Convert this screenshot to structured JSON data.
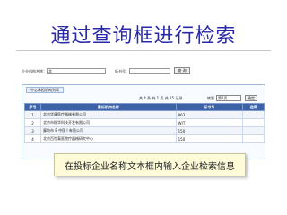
{
  "slide": {
    "title": "通过查询框进行检索"
  },
  "search": {
    "name_label": "企业机构名称：",
    "name_value": "北",
    "number_label": "标书号：",
    "number_value": "",
    "query_button": "查 询"
  },
  "panel": {
    "tab_label": "中心承担机构列表"
  },
  "pager": {
    "info": "共 4 条  共 1 页  共 15 记录",
    "jump_label": "转到",
    "page_select": "第1页",
    "go_button": "确定"
  },
  "table": {
    "headers": [
      "序号",
      "委标机构名称",
      "标书号",
      "选择"
    ],
    "rows": [
      {
        "no": "1",
        "name": "北京华康医疗器械有限公司",
        "number": "963",
        "select": ""
      },
      {
        "no": "2",
        "name": "北京市振华科技开发有限公司",
        "number": "W/T",
        "select": ""
      },
      {
        "no": "3",
        "name": "廊坊市 E 中国 I 有限公司",
        "number": "150",
        "select": ""
      },
      {
        "no": "4",
        "name": "北京百世泰医院疗器械研究中心",
        "number": "150",
        "select": ""
      }
    ]
  },
  "callout": {
    "text": "在投标企业名称文本框内输入企业检索信息"
  }
}
